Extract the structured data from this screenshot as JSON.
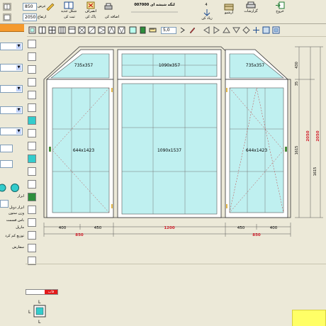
{
  "toolbar": {
    "width_label": "عرض",
    "width_value": "850",
    "height_label": "ارتفاع",
    "height_value": "2050",
    "new_shape_label": "شكل جديد",
    "cancel_label": "انصراف",
    "add_label": "اضافه كن",
    "delete_label": "پاک کن",
    "save_label": "ثبت کن",
    "window_title": "لنگه شیشه ای",
    "window_code": "007000",
    "item_number": "4",
    "enlarge_label": "زیاد کن",
    "archive_label": "آرشیو",
    "reports_label": "گزارشات",
    "exit_label": "خروج"
  },
  "zoom": {
    "value": "5,0"
  },
  "left_panel": {
    "label_1": "ابزار",
    "label_2": "ابزار دوبل",
    "label_3": "وزن ستون",
    "label_4": "باس قسمت",
    "label_5": "مارپل",
    "label_6": "توزیع کم کرد",
    "label_7": "سفارش"
  },
  "drawing": {
    "pane_top_left": "735x357",
    "pane_top_center": "1090x357",
    "pane_top_right": "735x357",
    "pane_left": "644x1423",
    "pane_center": "1090x1537",
    "pane_right": "644x1423",
    "dim_bottom": [
      "400",
      "450",
      "450",
      "400"
    ],
    "dim_bottom_totals": [
      "850",
      "1200",
      "850"
    ],
    "dim_right": [
      "430",
      "35",
      "2050",
      "1615",
      "2050",
      "1615"
    ]
  },
  "bottom": {
    "status_tag": "قاب",
    "preview_label_top": "L",
    "preview_label_left": "L",
    "preview_label_bottom": "L"
  },
  "colors": {
    "glass": "#bff0f0",
    "frame": "#ffffff",
    "dimension": "#d0202c",
    "accent_orange": "#f59a2d"
  }
}
